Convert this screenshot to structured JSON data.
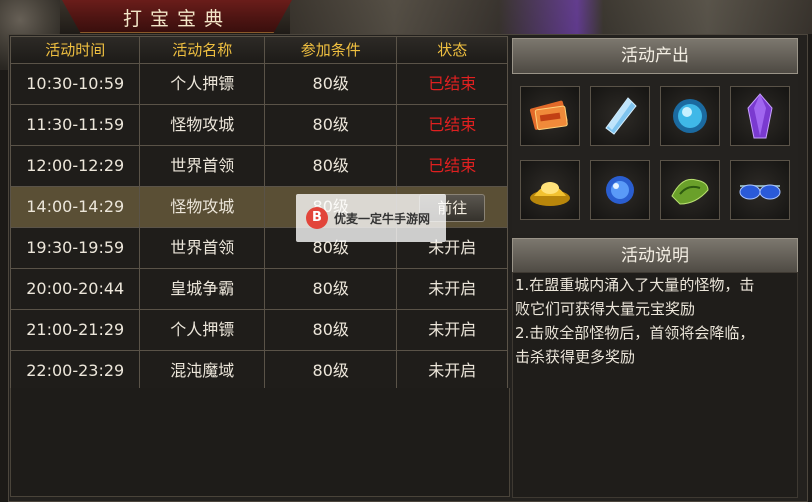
{
  "header": {
    "title": "打宝宝典"
  },
  "table": {
    "columns": [
      "活动时间",
      "活动名称",
      "参加条件",
      "状态"
    ],
    "rows": [
      {
        "time": "10:30-10:59",
        "name": "个人押镖",
        "req": "80级",
        "status": "已结束"
      },
      {
        "time": "11:30-11:59",
        "name": "怪物攻城",
        "req": "80级",
        "status": "已结束"
      },
      {
        "time": "12:00-12:29",
        "name": "世界首领",
        "req": "80级",
        "status": "已结束"
      },
      {
        "time": "14:00-14:29",
        "name": "怪物攻城",
        "req": "80级",
        "status": "前往"
      },
      {
        "time": "19:30-19:59",
        "name": "世界首领",
        "req": "80级",
        "status": "未开启"
      },
      {
        "time": "20:00-20:44",
        "name": "皇城争霸",
        "req": "80级",
        "status": "未开启"
      },
      {
        "time": "21:00-21:29",
        "name": "个人押镖",
        "req": "80级",
        "status": "未开启"
      },
      {
        "time": "22:00-23:29",
        "name": "混沌魔域",
        "req": "80级",
        "status": "未开启"
      }
    ]
  },
  "rewards": {
    "title": "活动产出",
    "items": [
      "ticket-bundle-icon",
      "ice-crystal-icon",
      "blue-orb-icon",
      "purple-crystal-icon",
      "gold-ingot-icon",
      "blue-sphere-icon",
      "green-scroll-icon",
      "sunglasses-icon"
    ]
  },
  "description": {
    "title": "活动说明",
    "lines": [
      "1.在盟重城内涌入了大量的怪物，击",
      "败它们可获得大量元宝奖励",
      "2.击败全部怪物后，首领将会降临，",
      "击杀获得更多奖励"
    ]
  },
  "watermark": {
    "text": "优麦一定牛手游网",
    "logo": "B"
  },
  "colors": {
    "accent": "#f0c040",
    "ended": "#e02020",
    "selected_row": "#5a4f35"
  }
}
